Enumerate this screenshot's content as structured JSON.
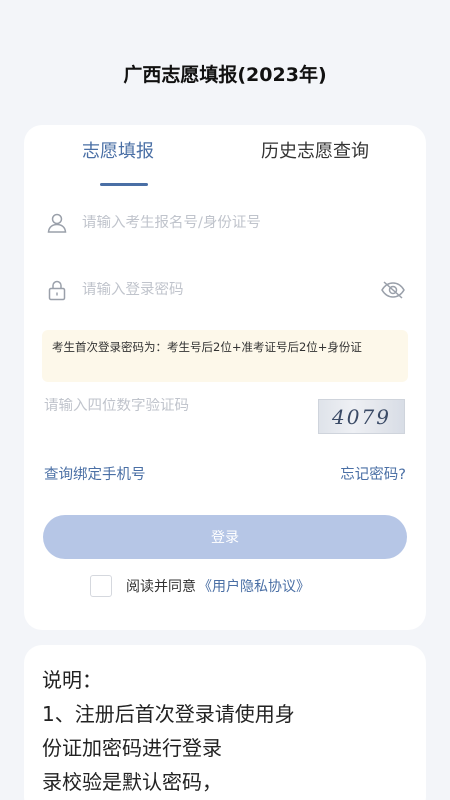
{
  "page": {
    "title": "广西志愿填报(2023年)"
  },
  "tabs": [
    {
      "label": "志愿填报",
      "active": true
    },
    {
      "label": "历史志愿查询",
      "active": false
    }
  ],
  "form": {
    "username_placeholder": "请输入考生报名号/身份证号",
    "password_placeholder": "请输入登录密码",
    "hint": "考生首次登录密码为：考生号后2位+准考证号后2位+身份证",
    "captcha_placeholder": "请输入四位数字验证码",
    "captcha_text": "4079",
    "bind_phone_link": "查询绑定手机号",
    "forgot_password_link": "忘记密码?",
    "login_button": "登录",
    "agree_text": "阅读并同意",
    "agreement_link": "《用户隐私协议》"
  },
  "notes": {
    "heading": "说明：",
    "line1": "1、注册后首次登录请使用身",
    "line2": "份证加密码进行登录",
    "line3": "录校验是默认密码，"
  },
  "colors": {
    "accent": "#4a6fa5",
    "button_bg": "#b6c6e6",
    "hint_bg": "#fdf8ea",
    "background": "#f3f5f9"
  },
  "icons": {
    "username": "user-icon",
    "password": "lock-icon",
    "toggle": "eye-off-icon"
  }
}
